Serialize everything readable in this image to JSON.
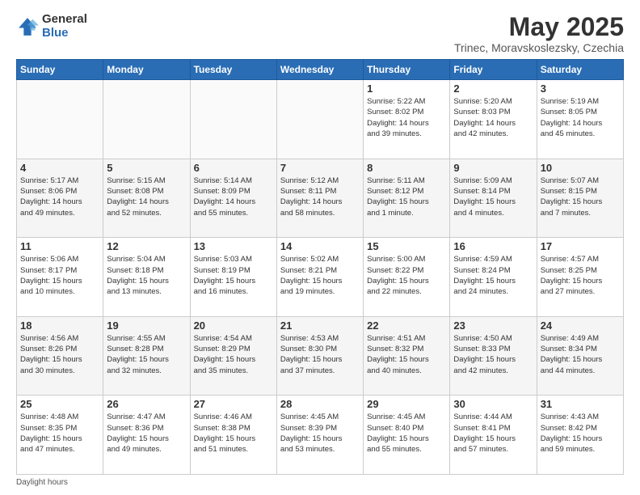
{
  "header": {
    "logo_general": "General",
    "logo_blue": "Blue",
    "title": "May 2025",
    "subtitle": "Trinec, Moravskoslezsky, Czechia"
  },
  "days_of_week": [
    "Sunday",
    "Monday",
    "Tuesday",
    "Wednesday",
    "Thursday",
    "Friday",
    "Saturday"
  ],
  "weeks": [
    [
      {
        "day": "",
        "info": ""
      },
      {
        "day": "",
        "info": ""
      },
      {
        "day": "",
        "info": ""
      },
      {
        "day": "",
        "info": ""
      },
      {
        "day": "1",
        "info": "Sunrise: 5:22 AM\nSunset: 8:02 PM\nDaylight: 14 hours\nand 39 minutes."
      },
      {
        "day": "2",
        "info": "Sunrise: 5:20 AM\nSunset: 8:03 PM\nDaylight: 14 hours\nand 42 minutes."
      },
      {
        "day": "3",
        "info": "Sunrise: 5:19 AM\nSunset: 8:05 PM\nDaylight: 14 hours\nand 45 minutes."
      }
    ],
    [
      {
        "day": "4",
        "info": "Sunrise: 5:17 AM\nSunset: 8:06 PM\nDaylight: 14 hours\nand 49 minutes."
      },
      {
        "day": "5",
        "info": "Sunrise: 5:15 AM\nSunset: 8:08 PM\nDaylight: 14 hours\nand 52 minutes."
      },
      {
        "day": "6",
        "info": "Sunrise: 5:14 AM\nSunset: 8:09 PM\nDaylight: 14 hours\nand 55 minutes."
      },
      {
        "day": "7",
        "info": "Sunrise: 5:12 AM\nSunset: 8:11 PM\nDaylight: 14 hours\nand 58 minutes."
      },
      {
        "day": "8",
        "info": "Sunrise: 5:11 AM\nSunset: 8:12 PM\nDaylight: 15 hours\nand 1 minute."
      },
      {
        "day": "9",
        "info": "Sunrise: 5:09 AM\nSunset: 8:14 PM\nDaylight: 15 hours\nand 4 minutes."
      },
      {
        "day": "10",
        "info": "Sunrise: 5:07 AM\nSunset: 8:15 PM\nDaylight: 15 hours\nand 7 minutes."
      }
    ],
    [
      {
        "day": "11",
        "info": "Sunrise: 5:06 AM\nSunset: 8:17 PM\nDaylight: 15 hours\nand 10 minutes."
      },
      {
        "day": "12",
        "info": "Sunrise: 5:04 AM\nSunset: 8:18 PM\nDaylight: 15 hours\nand 13 minutes."
      },
      {
        "day": "13",
        "info": "Sunrise: 5:03 AM\nSunset: 8:19 PM\nDaylight: 15 hours\nand 16 minutes."
      },
      {
        "day": "14",
        "info": "Sunrise: 5:02 AM\nSunset: 8:21 PM\nDaylight: 15 hours\nand 19 minutes."
      },
      {
        "day": "15",
        "info": "Sunrise: 5:00 AM\nSunset: 8:22 PM\nDaylight: 15 hours\nand 22 minutes."
      },
      {
        "day": "16",
        "info": "Sunrise: 4:59 AM\nSunset: 8:24 PM\nDaylight: 15 hours\nand 24 minutes."
      },
      {
        "day": "17",
        "info": "Sunrise: 4:57 AM\nSunset: 8:25 PM\nDaylight: 15 hours\nand 27 minutes."
      }
    ],
    [
      {
        "day": "18",
        "info": "Sunrise: 4:56 AM\nSunset: 8:26 PM\nDaylight: 15 hours\nand 30 minutes."
      },
      {
        "day": "19",
        "info": "Sunrise: 4:55 AM\nSunset: 8:28 PM\nDaylight: 15 hours\nand 32 minutes."
      },
      {
        "day": "20",
        "info": "Sunrise: 4:54 AM\nSunset: 8:29 PM\nDaylight: 15 hours\nand 35 minutes."
      },
      {
        "day": "21",
        "info": "Sunrise: 4:53 AM\nSunset: 8:30 PM\nDaylight: 15 hours\nand 37 minutes."
      },
      {
        "day": "22",
        "info": "Sunrise: 4:51 AM\nSunset: 8:32 PM\nDaylight: 15 hours\nand 40 minutes."
      },
      {
        "day": "23",
        "info": "Sunrise: 4:50 AM\nSunset: 8:33 PM\nDaylight: 15 hours\nand 42 minutes."
      },
      {
        "day": "24",
        "info": "Sunrise: 4:49 AM\nSunset: 8:34 PM\nDaylight: 15 hours\nand 44 minutes."
      }
    ],
    [
      {
        "day": "25",
        "info": "Sunrise: 4:48 AM\nSunset: 8:35 PM\nDaylight: 15 hours\nand 47 minutes."
      },
      {
        "day": "26",
        "info": "Sunrise: 4:47 AM\nSunset: 8:36 PM\nDaylight: 15 hours\nand 49 minutes."
      },
      {
        "day": "27",
        "info": "Sunrise: 4:46 AM\nSunset: 8:38 PM\nDaylight: 15 hours\nand 51 minutes."
      },
      {
        "day": "28",
        "info": "Sunrise: 4:45 AM\nSunset: 8:39 PM\nDaylight: 15 hours\nand 53 minutes."
      },
      {
        "day": "29",
        "info": "Sunrise: 4:45 AM\nSunset: 8:40 PM\nDaylight: 15 hours\nand 55 minutes."
      },
      {
        "day": "30",
        "info": "Sunrise: 4:44 AM\nSunset: 8:41 PM\nDaylight: 15 hours\nand 57 minutes."
      },
      {
        "day": "31",
        "info": "Sunrise: 4:43 AM\nSunset: 8:42 PM\nDaylight: 15 hours\nand 59 minutes."
      }
    ]
  ],
  "footer": {
    "note": "Daylight hours"
  }
}
